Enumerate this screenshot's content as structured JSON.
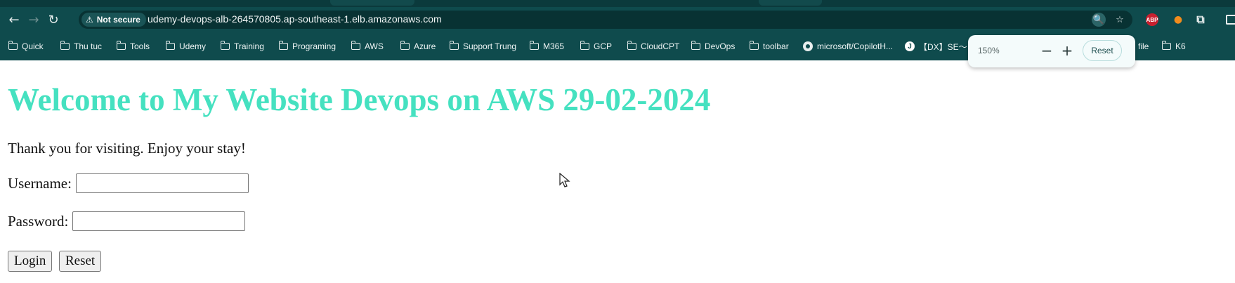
{
  "browser": {
    "nav": {
      "back_icon": "arrow-left-icon",
      "forward_icon": "arrow-right-icon",
      "reload_icon": "reload-icon"
    },
    "omnibox": {
      "security_label": "Not secure",
      "url": "udemy-devops-alb-264570805.ap-southeast-1.elb.amazonaws.com"
    },
    "extensions": {
      "abp_label": "ABP"
    },
    "bookmarks": [
      {
        "label": "Quick",
        "icon": "folder-icon"
      },
      {
        "label": "Thu tuc",
        "icon": "folder-icon"
      },
      {
        "label": "Tools",
        "icon": "folder-icon"
      },
      {
        "label": "Udemy",
        "icon": "folder-icon"
      },
      {
        "label": "Training",
        "icon": "folder-icon"
      },
      {
        "label": "Programing",
        "icon": "folder-icon"
      },
      {
        "label": "AWS",
        "icon": "folder-icon"
      },
      {
        "label": "Azure",
        "icon": "folder-icon"
      },
      {
        "label": "Support Trung",
        "icon": "folder-icon"
      },
      {
        "label": "M365",
        "icon": "folder-icon"
      },
      {
        "label": "GCP",
        "icon": "folder-icon"
      },
      {
        "label": "CloudCPT",
        "icon": "folder-icon"
      },
      {
        "label": "DevOps",
        "icon": "folder-icon"
      },
      {
        "label": "toolbar",
        "icon": "folder-icon"
      },
      {
        "label": "microsoft/CopilotH...",
        "icon": "github-icon"
      },
      {
        "label": "【DX】SE〜コン",
        "icon": "site-icon"
      },
      {
        "label": "file",
        "icon": "none"
      },
      {
        "label": "K6",
        "icon": "folder-icon"
      }
    ],
    "zoom_popup": {
      "level": "150%",
      "decrease": "−",
      "increase": "+",
      "reset_label": "Reset"
    },
    "colors": {
      "chrome_bg": "#0f4b4d",
      "title_color": "#45e1c0"
    }
  },
  "page": {
    "title": "Welcome to My Website Devops on AWS 29-02-2024",
    "tagline": "Thank you for visiting. Enjoy your stay!",
    "form": {
      "username_label": "Username:",
      "username_value": "",
      "password_label": "Password:",
      "password_value": "",
      "login_label": "Login",
      "reset_label": "Reset"
    }
  }
}
